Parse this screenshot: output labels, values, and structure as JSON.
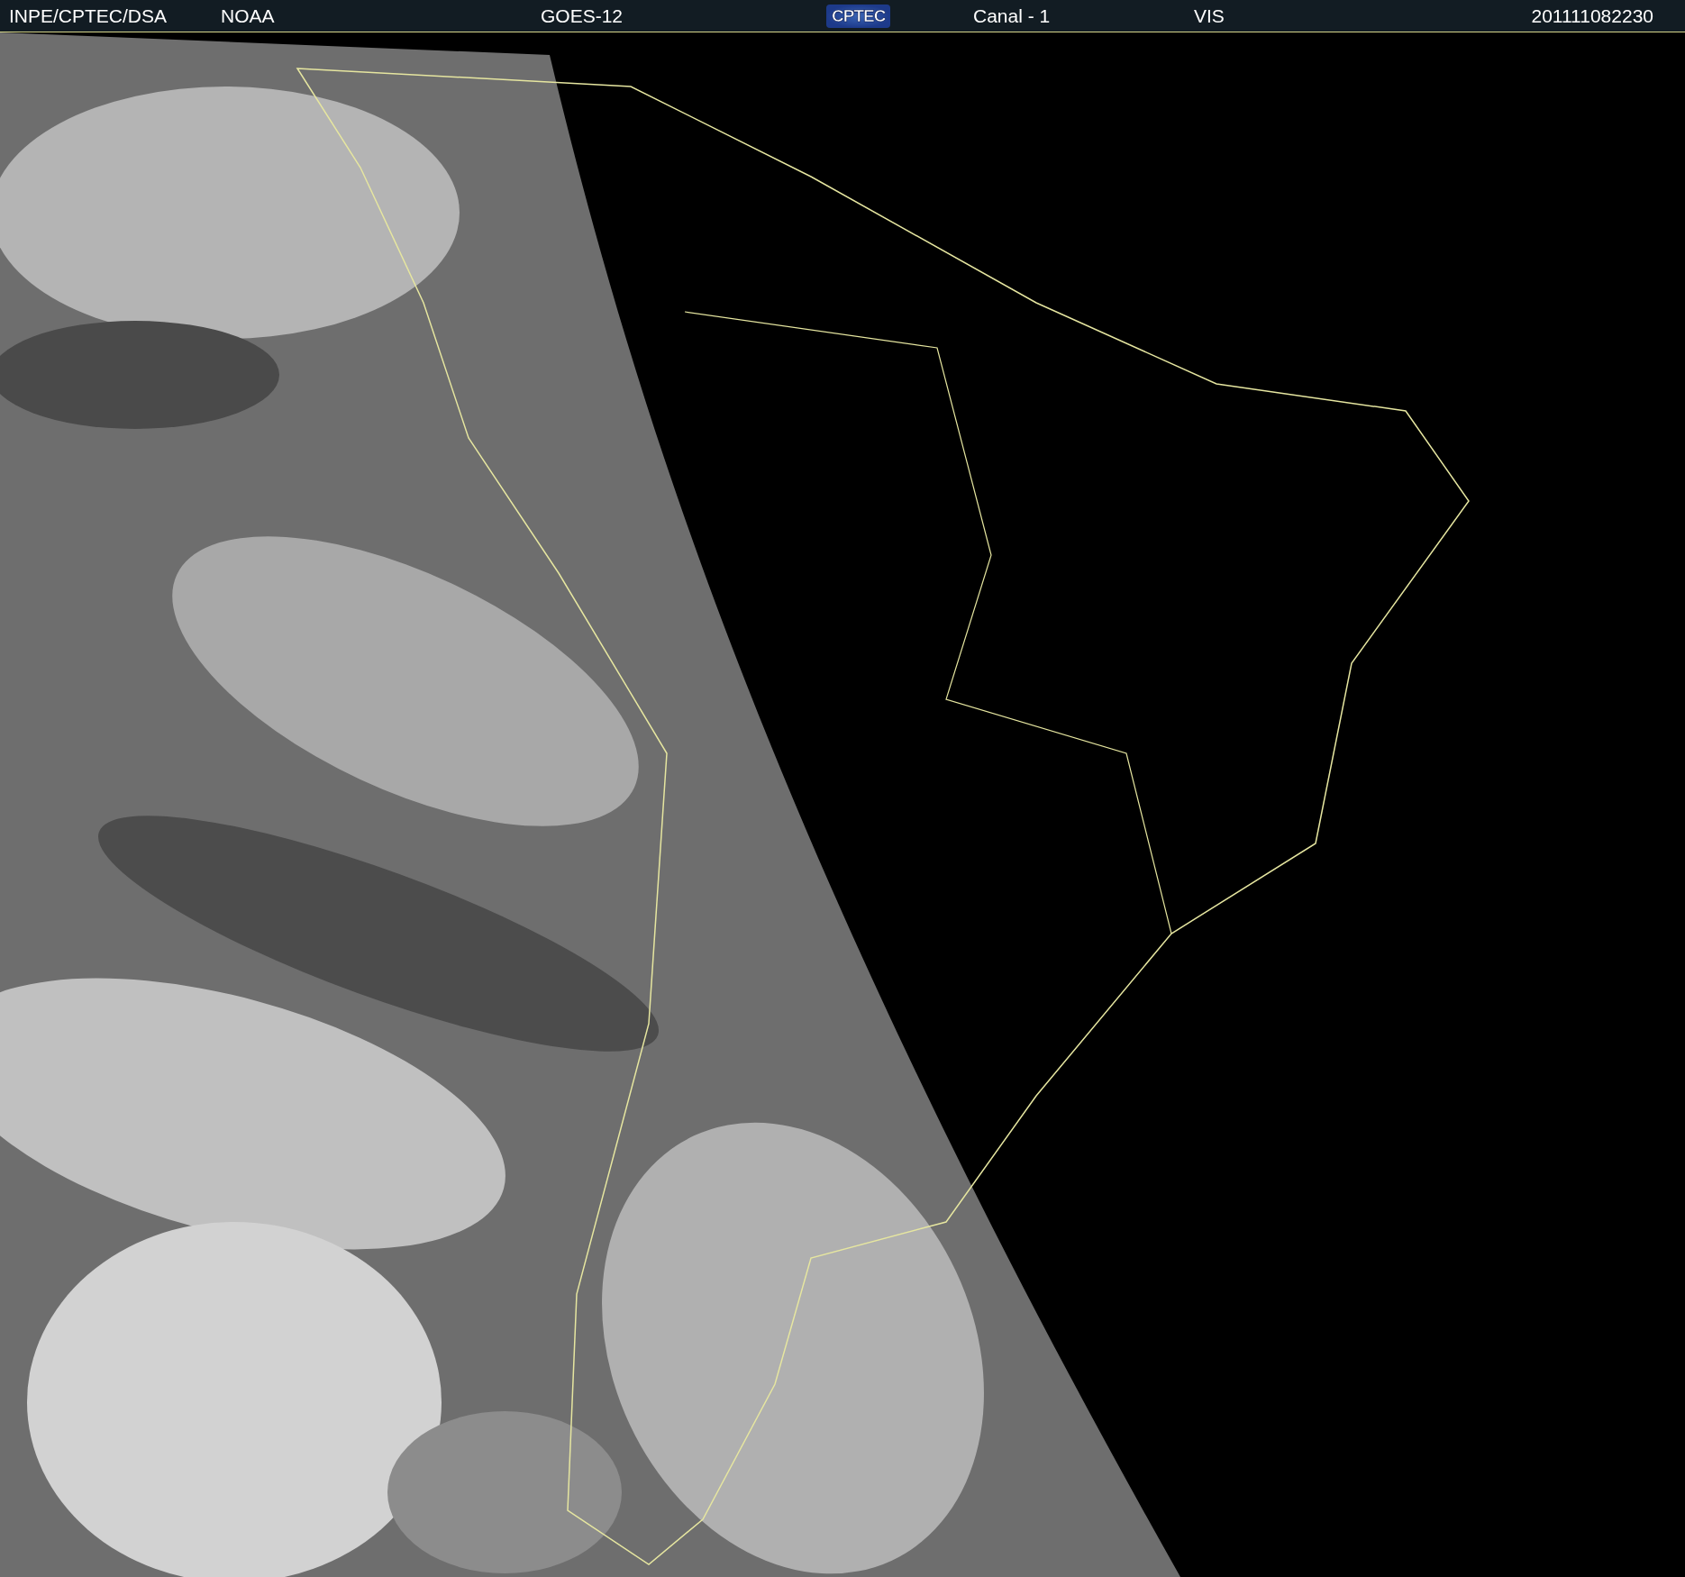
{
  "header": {
    "source": "INPE/CPTEC/DSA",
    "agency": "NOAA",
    "satellite": "GOES-12",
    "logo": "CPTEC",
    "channel": "Canal - 1",
    "band": "VIS",
    "timestamp": "201111082230"
  }
}
